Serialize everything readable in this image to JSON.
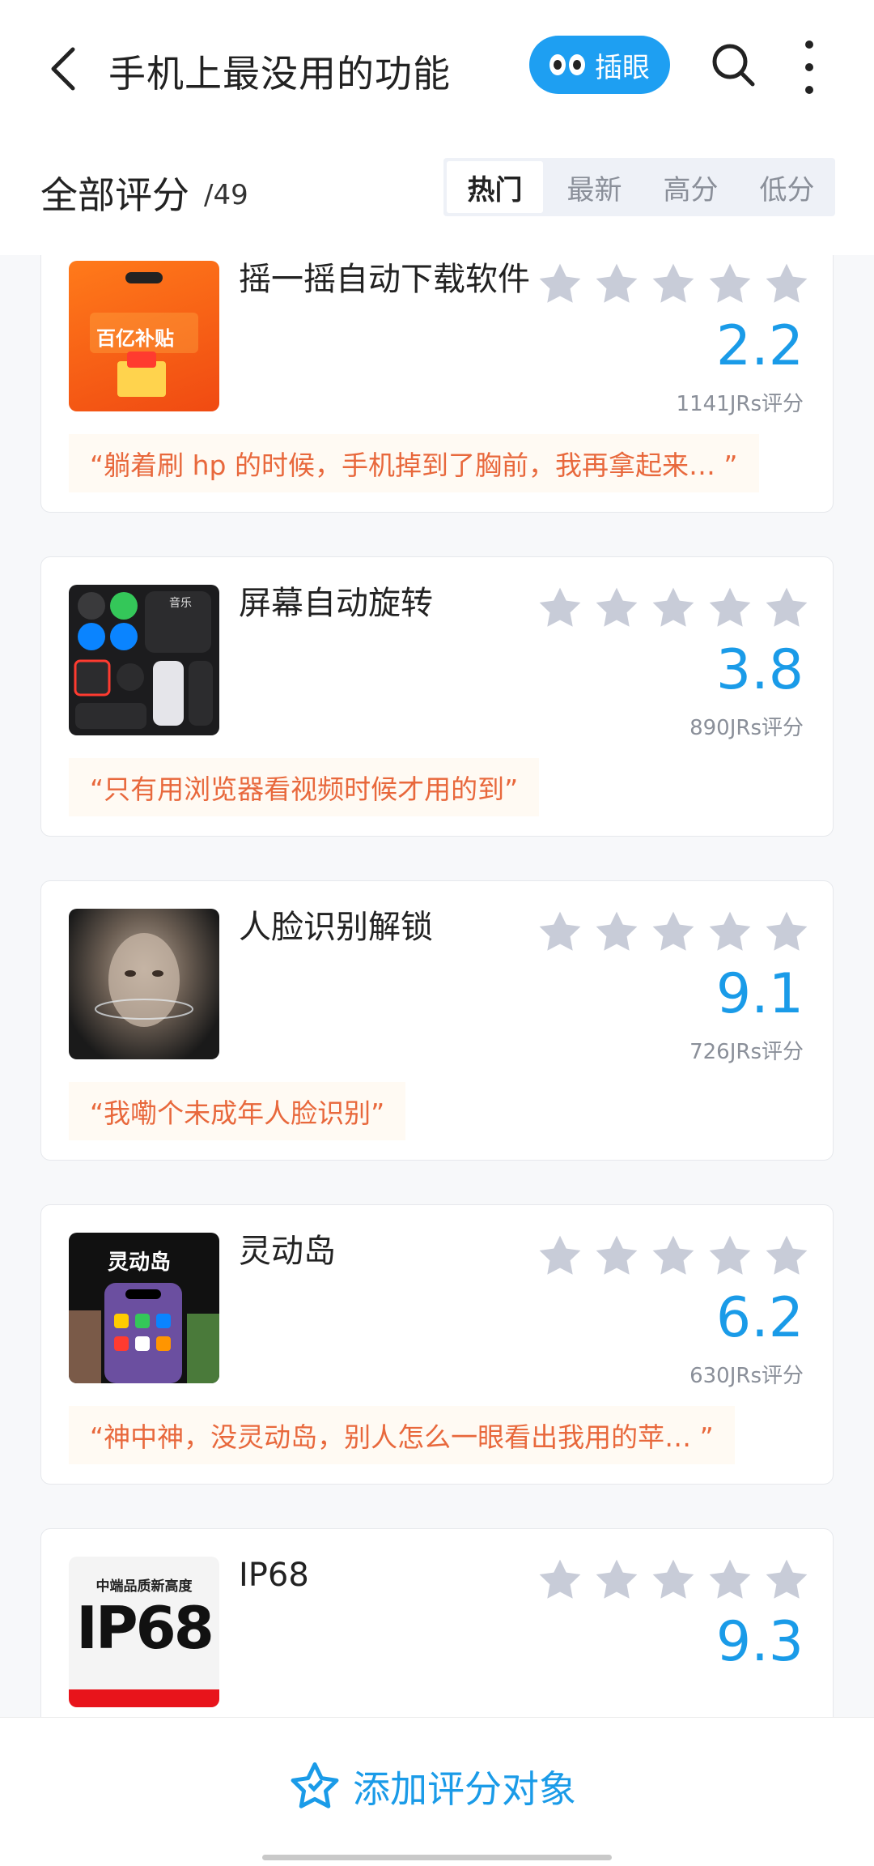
{
  "header": {
    "title": "手机上最没用的功能",
    "chayan_label": "插眼"
  },
  "subheader": {
    "all_ratings": "全部评分",
    "count": "/49",
    "tabs": [
      "热门",
      "最新",
      "高分",
      "低分"
    ],
    "active_tab": "热门"
  },
  "items": [
    {
      "name": "摇一摇自动下载软件",
      "score": "2.2",
      "raters": "1141JRs评分",
      "quote": "“躺着刷 hp 的时候，手机掉到了胸前，我再拿起来…  ”",
      "thumb_text": "百亿补贴"
    },
    {
      "name": "屏幕自动旋转",
      "score": "3.8",
      "raters": "890JRs评分",
      "quote": "“只有用浏览器看视频时候才用的到”",
      "thumb_text": "音乐"
    },
    {
      "name": "人脸识别解锁",
      "score": "9.1",
      "raters": "726JRs评分",
      "quote": "“我嘞个未成年人脸识别”",
      "thumb_text": ""
    },
    {
      "name": "灵动岛",
      "score": "6.2",
      "raters": "630JRs评分",
      "quote": "“神中神，没灵动岛，别人怎么一眼看出我用的苹…  ”",
      "thumb_text": "灵动岛"
    },
    {
      "name": "IP68",
      "score": "9.3",
      "raters": "",
      "quote": "",
      "thumb_text": "IP68",
      "thumb_sub": "中端品质新高度"
    }
  ],
  "bottom": {
    "add_label": "添加评分对象"
  },
  "colors": {
    "accent": "#1a9be8",
    "quote": "#e8683c",
    "star": "#c8ccd8"
  }
}
